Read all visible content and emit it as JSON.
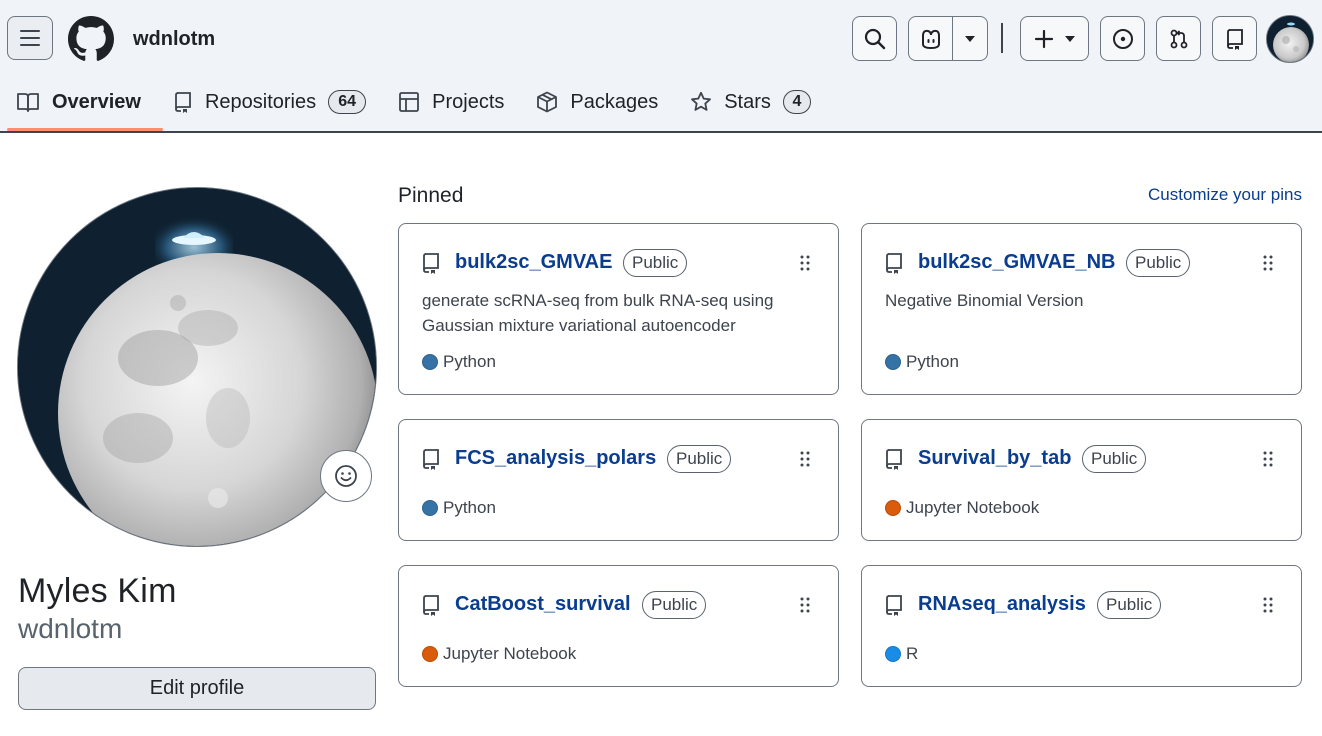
{
  "header": {
    "username": "wdnlotm"
  },
  "tabs": [
    {
      "label": "Overview",
      "icon": "book-icon",
      "active": true
    },
    {
      "label": "Repositories",
      "icon": "repo-icon",
      "count": "64"
    },
    {
      "label": "Projects",
      "icon": "table-icon"
    },
    {
      "label": "Packages",
      "icon": "package-icon"
    },
    {
      "label": "Stars",
      "icon": "star-icon",
      "count": "4"
    }
  ],
  "profile": {
    "name": "Myles Kim",
    "login": "wdnlotm",
    "edit_label": "Edit profile"
  },
  "pinned": {
    "title": "Pinned",
    "customize_label": "Customize your pins",
    "repos": [
      {
        "name": "bulk2sc_GMVAE",
        "visibility": "Public",
        "description": "generate scRNA-seq from bulk RNA-seq using Gaussian mixture variational autoencoder",
        "language": "Python",
        "lang_color": "#3572A5"
      },
      {
        "name": "bulk2sc_GMVAE_NB",
        "visibility": "Public",
        "description": "Negative Binomial Version",
        "language": "Python",
        "lang_color": "#3572A5"
      },
      {
        "name": "FCS_analysis_polars",
        "visibility": "Public",
        "description": "",
        "language": "Python",
        "lang_color": "#3572A5"
      },
      {
        "name": "Survival_by_tab",
        "visibility": "Public",
        "description": "",
        "language": "Jupyter Notebook",
        "lang_color": "#DA5B0B"
      },
      {
        "name": "CatBoost_survival",
        "visibility": "Public",
        "description": "",
        "language": "Jupyter Notebook",
        "lang_color": "#DA5B0B"
      },
      {
        "name": "RNAseq_analysis",
        "visibility": "Public",
        "description": "",
        "language": "R",
        "lang_color": "#198CE7"
      }
    ]
  },
  "colors": {
    "link": "#0a3d8f",
    "active_tab_underline": "#fd8c73"
  }
}
